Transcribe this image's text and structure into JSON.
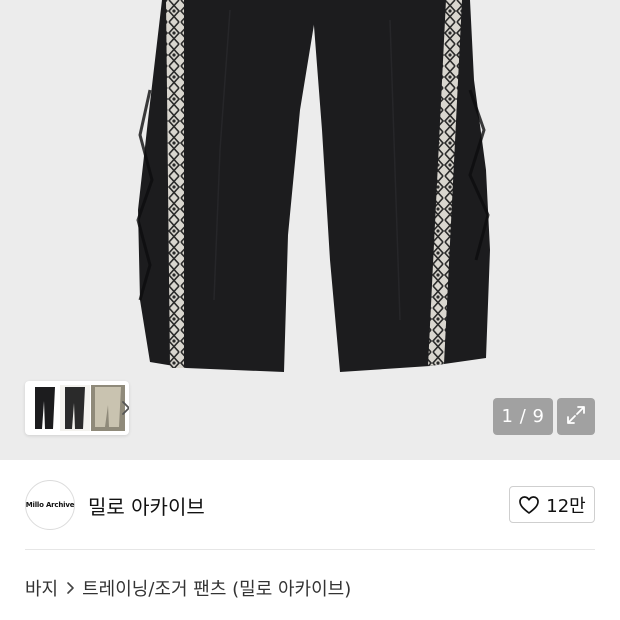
{
  "gallery": {
    "current_index": "1",
    "total": "9",
    "counter_text": "1 / 9",
    "icons": {
      "more": "chevron-right-icon",
      "expand": "expand-arrows-icon"
    }
  },
  "shop": {
    "logo_text": "Millo Archive",
    "name": "밀로 아카이브",
    "like_count": "12만",
    "like_icon": "heart-outline-icon"
  },
  "breadcrumb": {
    "items": [
      {
        "label": "바지"
      },
      {
        "label": "트레이닝/조거 팬츠 (밀로 아카이브)"
      }
    ],
    "separator_icon": "chevron-right-icon"
  },
  "colors": {
    "hero_background": "#ececec",
    "overlay": "#8c8c8c",
    "pants": "#1c1c1e",
    "stripe": "#d9d6cf"
  }
}
